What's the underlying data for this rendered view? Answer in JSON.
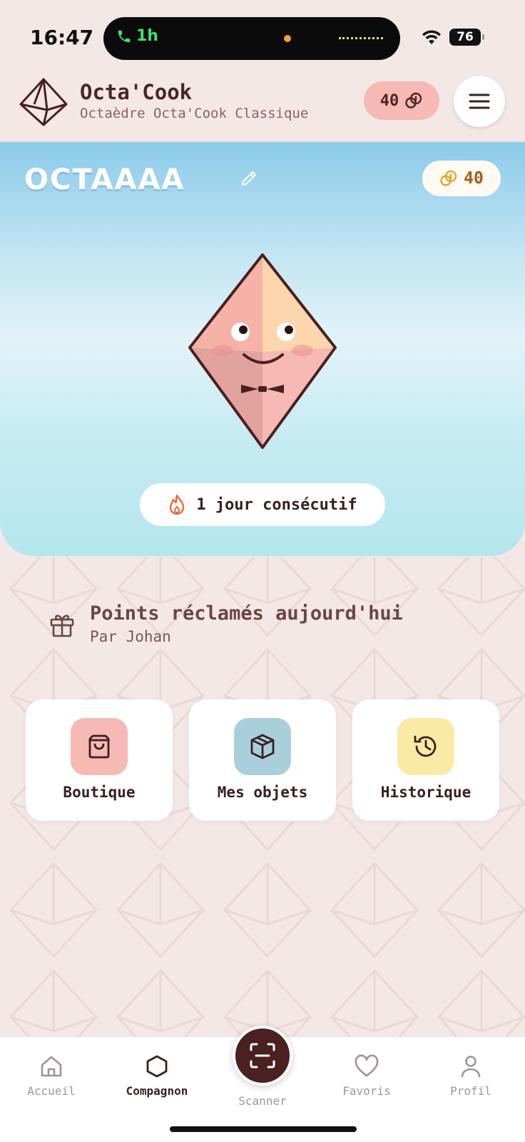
{
  "status_bar": {
    "time": "16:47",
    "call_duration": "1h",
    "battery": "76",
    "icons": [
      "phone-icon",
      "wifi-icon",
      "battery-icon"
    ]
  },
  "header": {
    "title": "Octa'Cook",
    "subtitle": "Octaèdre Octa'Cook Classique",
    "points": "40",
    "icons": [
      "octahedron-logo-icon",
      "coin-icon",
      "menu-icon"
    ]
  },
  "hero": {
    "pet_name": "OCTAAAA",
    "coins": "40",
    "streak_text": "1 jour consécutif",
    "icons": [
      "edit-icon",
      "coin-icon",
      "flame-icon",
      "octahedron-mascot"
    ]
  },
  "claim": {
    "title": "Points réclamés aujourd'hui",
    "subtitle": "Par Johan",
    "icon": "gift-icon"
  },
  "cards": [
    {
      "label": "Boutique",
      "icon": "shopping-bag-icon",
      "color": "#f7b9b4"
    },
    {
      "label": "Mes objets",
      "icon": "box-icon",
      "color": "#a9cfdd"
    },
    {
      "label": "Historique",
      "icon": "history-icon",
      "color": "#fbeaa5"
    }
  ],
  "bottom_nav": {
    "items": [
      {
        "label": "Accueil",
        "icon": "home-icon"
      },
      {
        "label": "Compagnon",
        "icon": "hexagon-icon",
        "active": true
      },
      {
        "label": "Scanner",
        "icon": "scan-icon"
      },
      {
        "label": "Favoris",
        "icon": "heart-icon"
      },
      {
        "label": "Profil",
        "icon": "user-icon"
      }
    ]
  },
  "colors": {
    "background": "#f3e8e6",
    "brand_dark": "#4a2020",
    "accent_pink": "#f7b9b4",
    "hero_blue": "#8ccbea"
  }
}
